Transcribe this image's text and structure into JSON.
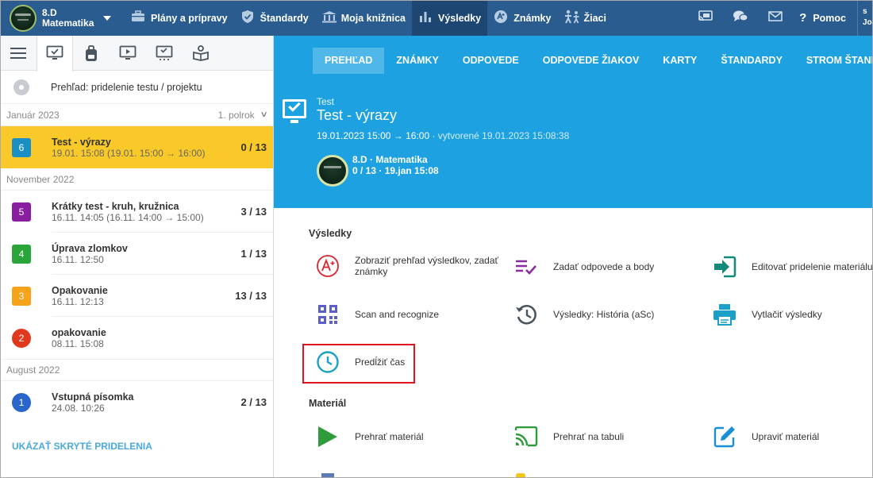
{
  "topbar": {
    "class_name": "8.D",
    "subject": "Matematika",
    "nav": [
      {
        "label": "Plány a prípravy",
        "icon": "briefcase-icon"
      },
      {
        "label": "Štandardy",
        "icon": "shield-icon"
      },
      {
        "label": "Moja knižnica",
        "icon": "library-icon"
      },
      {
        "label": "Výsledky",
        "icon": "bar-chart-icon"
      },
      {
        "label": "Známky",
        "icon": "grades-icon"
      },
      {
        "label": "Žiaci",
        "icon": "students-icon"
      }
    ],
    "help_label": "Pomoc",
    "user_initials": "s",
    "user_name_partial": "Jo"
  },
  "left_panel": {
    "overview_label": "Prehľad: pridelenie testu / projektu",
    "month_jan": "Január 2023",
    "semester": "1. polrok",
    "month_nov": "November 2022",
    "month_aug": "August 2022",
    "items": [
      {
        "num": "6",
        "title": "Test - výrazy",
        "sub": "19.01. 15:08 (19.01. 15:00 → 16:00)",
        "score": "0 / 13",
        "color": "#1a8fc4"
      },
      {
        "num": "5",
        "title": "Krátky test - kruh, kružnica",
        "sub": "16.11. 14:05 (16.11. 14:00 → 15:00)",
        "score": "3 / 13",
        "color": "#8a1ea0"
      },
      {
        "num": "4",
        "title": "Úprava zlomkov",
        "sub": "16.11. 12:50",
        "score": "1 / 13",
        "color": "#2aa53a"
      },
      {
        "num": "3",
        "title": "Opakovanie",
        "sub": "16.11. 12:13",
        "score": "13 / 13",
        "color": "#f7a21b"
      },
      {
        "num": "2",
        "title": "opakovanie",
        "sub": "08.11. 15:08",
        "score": "",
        "color": "#e0391e"
      },
      {
        "num": "1",
        "title": "Vstupná písomka",
        "sub": "24.08. 10:26",
        "score": "2 / 13",
        "color": "#2a66c9"
      }
    ],
    "show_hidden": "UKÁZAŤ SKRYTÉ PRIDELENIA"
  },
  "right_panel": {
    "tabs": [
      "PREHĽAD",
      "ZNÁMKY",
      "ODPOVEDE",
      "ODPOVEDE ŽIAKOV",
      "KARTY",
      "ŠTANDARDY",
      "STROM ŠTANDARDOV"
    ],
    "header": {
      "type": "Test",
      "title": "Test - výrazy",
      "date": "19.01.2023 15:00 → 16:00",
      "created": "· vytvorené 19.01.2023 15:08:38",
      "class_label": "8.D · Matematika",
      "stat": "0 / 13 · 19.jan 15:08"
    },
    "results_title": "Výsledky",
    "actions": [
      {
        "label": "Zobraziť prehľad výsledkov, zadať známky",
        "icon": "grade-a-icon"
      },
      {
        "label": "Zadať odpovede a body",
        "icon": "checklist-icon"
      },
      {
        "label": "Editovať pridelenie materiálu",
        "icon": "edit-assignment-icon"
      },
      {
        "label": "Scan and recognize",
        "icon": "qr-code-icon"
      },
      {
        "label": "Výsledky: História (aSc)",
        "icon": "history-icon"
      },
      {
        "label": "Vytlačiť výsledky",
        "icon": "printer-icon"
      },
      {
        "label": "Predĺžiť čas",
        "icon": "clock-icon"
      }
    ],
    "material_title": "Materiál",
    "material_actions": [
      {
        "label": "Prehrať materiál",
        "icon": "play-icon"
      },
      {
        "label": "Prehrať na tabuli",
        "icon": "cast-icon"
      },
      {
        "label": "Upraviť materiál",
        "icon": "pencil-edit-icon"
      }
    ]
  }
}
